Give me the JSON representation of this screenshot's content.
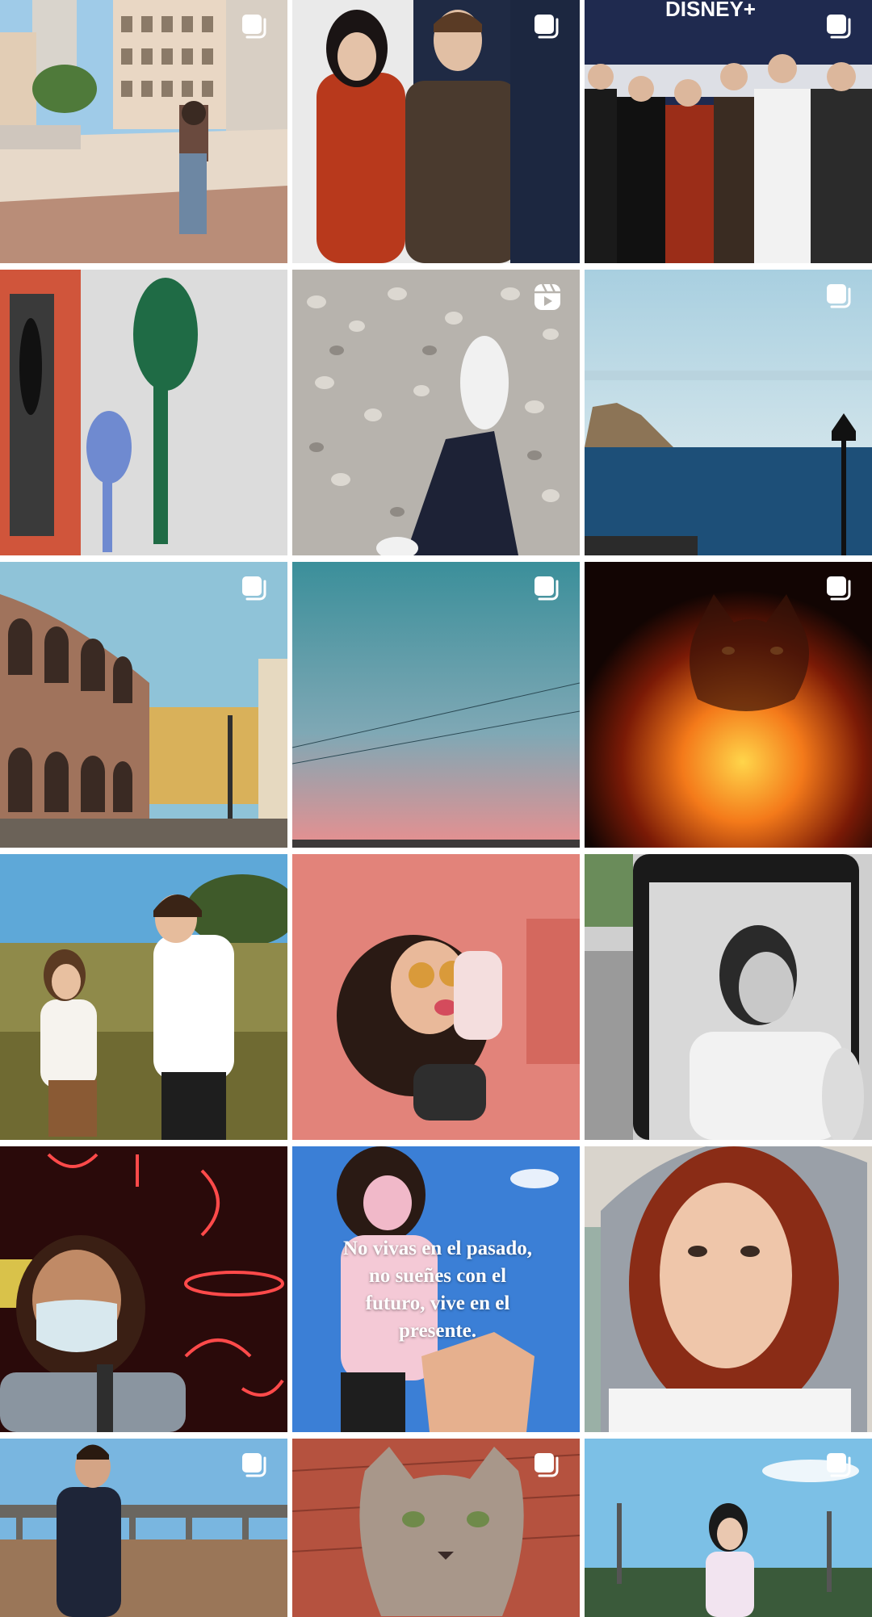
{
  "grid": {
    "tiles": [
      {
        "subject": "girl-plaza-street-photo",
        "badge": "carousel-icon"
      },
      {
        "subject": "two-actors-premiere-photo",
        "badge": "carousel-icon"
      },
      {
        "subject": "cast-group-premiere-photo",
        "badge": "carousel-icon",
        "backdrop_text": "DISNEY+"
      },
      {
        "subject": "colorful-mural-silhouettes-photo",
        "badge": ""
      },
      {
        "subject": "foot-on-pebbles-photo",
        "badge": "reels-icon"
      },
      {
        "subject": "sea-cliff-lamppost-photo",
        "badge": "carousel-icon"
      },
      {
        "subject": "roman-arena-verona-photo",
        "badge": "carousel-icon"
      },
      {
        "subject": "sunset-sky-photo",
        "badge": "carousel-icon"
      },
      {
        "subject": "cat-firelight-photo",
        "badge": "carousel-icon"
      },
      {
        "subject": "children-field-photo",
        "badge": ""
      },
      {
        "subject": "girl-pink-wall-photo",
        "badge": ""
      },
      {
        "subject": "girl-mirror-bw-photo",
        "badge": ""
      },
      {
        "subject": "girl-mask-neon-photo",
        "badge": ""
      },
      {
        "subject": "quote-blue-sky-photo",
        "badge": "",
        "quote": "No vivas en el pasado, no sueñes con el futuro, vive en el presente."
      },
      {
        "subject": "redhead-hood-portrait-photo",
        "badge": ""
      },
      {
        "subject": "man-bridge-photo",
        "badge": "carousel-icon"
      },
      {
        "subject": "tabby-cat-photo",
        "badge": "carousel-icon"
      },
      {
        "subject": "girl-palms-photo",
        "badge": "carousel-icon"
      }
    ]
  },
  "colors": {
    "background": "#ffffff",
    "badge": "#ffffff"
  }
}
